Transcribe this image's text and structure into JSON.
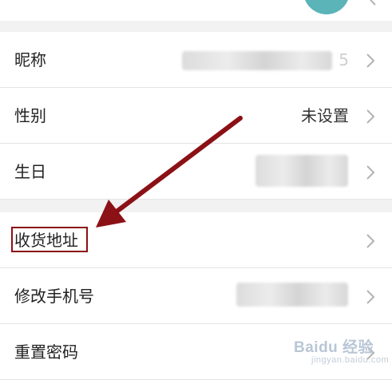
{
  "profile": {
    "rows": [
      {
        "label": "昵称",
        "value": ""
      },
      {
        "label": "性别",
        "value": "未设置"
      },
      {
        "label": "生日",
        "value": ""
      },
      {
        "label": "收货地址",
        "value": ""
      },
      {
        "label": "修改手机号",
        "value": ""
      },
      {
        "label": "重置密码",
        "value": ""
      }
    ],
    "nickname_tail": "5"
  },
  "icons": {
    "chevron": "chevron-right-icon",
    "avatar": "avatar"
  },
  "colors": {
    "highlight": "#8b1116",
    "background": "#f2f2f2",
    "row": "#ffffff"
  },
  "watermark": {
    "text": "Baidu 经验",
    "sub": "jingyan.baidu.com"
  }
}
